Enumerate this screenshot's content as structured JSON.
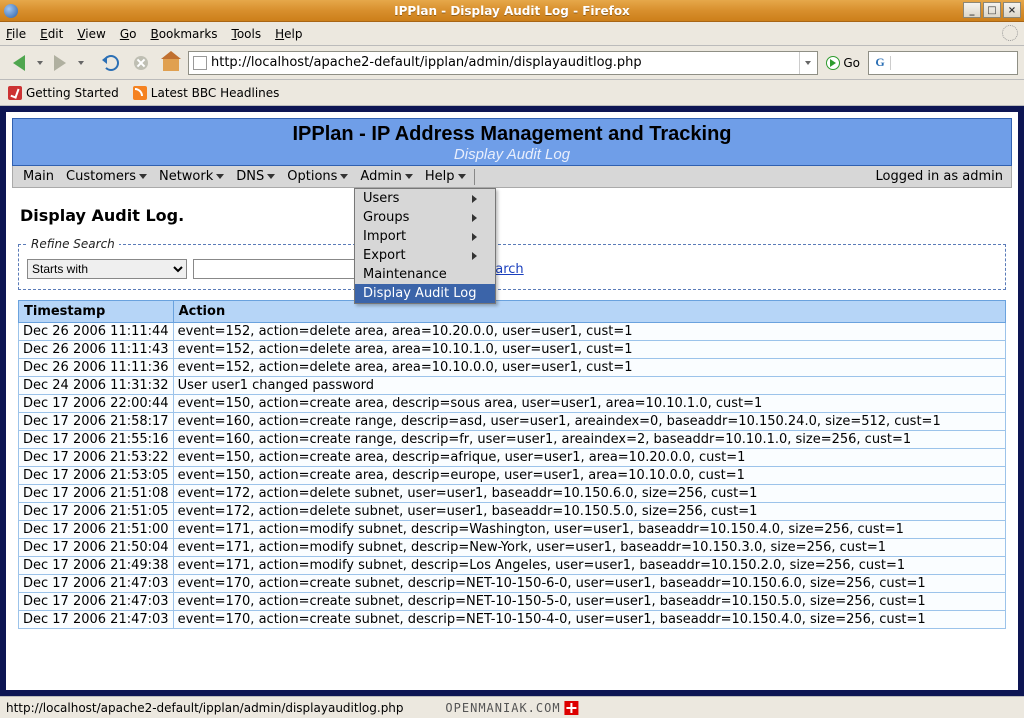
{
  "window": {
    "title": "IPPlan - Display Audit Log - Firefox"
  },
  "browser_menu": {
    "file": "File",
    "edit": "Edit",
    "view": "View",
    "go": "Go",
    "bookmarks": "Bookmarks",
    "tools": "Tools",
    "help": "Help"
  },
  "navbar": {
    "url": "http://localhost/apache2-default/ipplan/admin/displayauditlog.php",
    "go_label": "Go"
  },
  "bookmarks": {
    "getting_started": "Getting Started",
    "bbc": "Latest BBC Headlines"
  },
  "app": {
    "title": "IPPlan - IP Address Management and Tracking",
    "subtitle": "Display Audit Log",
    "login_status": "Logged in as admin",
    "menu": {
      "main": "Main",
      "customers": "Customers",
      "network": "Network",
      "dns": "DNS",
      "options": "Options",
      "admin": "Admin",
      "help": "Help"
    },
    "admin_menu": {
      "users": "Users",
      "groups": "Groups",
      "import": "Import",
      "export": "Export",
      "maintenance": "Maintenance",
      "display_audit_log": "Display Audit Log"
    },
    "page_heading": "Display Audit Log.",
    "refine": {
      "legend": "Refine Search",
      "mode": "Starts with",
      "query": "",
      "search_label": "Search"
    },
    "table": {
      "headers": {
        "timestamp": "Timestamp",
        "action": "Action"
      },
      "rows": [
        {
          "ts": "Dec 26 2006 11:11:44",
          "action": "event=152, action=delete area, area=10.20.0.0, user=user1, cust=1"
        },
        {
          "ts": "Dec 26 2006 11:11:43",
          "action": "event=152, action=delete area, area=10.10.1.0, user=user1, cust=1"
        },
        {
          "ts": "Dec 26 2006 11:11:36",
          "action": "event=152, action=delete area, area=10.10.0.0, user=user1, cust=1"
        },
        {
          "ts": "Dec 24 2006 11:31:32",
          "action": "User user1 changed password"
        },
        {
          "ts": "Dec 17 2006 22:00:44",
          "action": "event=150, action=create area, descrip=sous area, user=user1, area=10.10.1.0, cust=1"
        },
        {
          "ts": "Dec 17 2006 21:58:17",
          "action": "event=160, action=create range, descrip=asd, user=user1, areaindex=0, baseaddr=10.150.24.0, size=512, cust=1"
        },
        {
          "ts": "Dec 17 2006 21:55:16",
          "action": "event=160, action=create range, descrip=fr, user=user1, areaindex=2, baseaddr=10.10.1.0, size=256, cust=1"
        },
        {
          "ts": "Dec 17 2006 21:53:22",
          "action": "event=150, action=create area, descrip=afrique, user=user1, area=10.20.0.0, cust=1"
        },
        {
          "ts": "Dec 17 2006 21:53:05",
          "action": "event=150, action=create area, descrip=europe, user=user1, area=10.10.0.0, cust=1"
        },
        {
          "ts": "Dec 17 2006 21:51:08",
          "action": "event=172, action=delete subnet, user=user1, baseaddr=10.150.6.0, size=256, cust=1"
        },
        {
          "ts": "Dec 17 2006 21:51:05",
          "action": "event=172, action=delete subnet, user=user1, baseaddr=10.150.5.0, size=256, cust=1"
        },
        {
          "ts": "Dec 17 2006 21:51:00",
          "action": "event=171, action=modify subnet, descrip=Washington, user=user1, baseaddr=10.150.4.0, size=256, cust=1"
        },
        {
          "ts": "Dec 17 2006 21:50:04",
          "action": "event=171, action=modify subnet, descrip=New-York, user=user1, baseaddr=10.150.3.0, size=256, cust=1"
        },
        {
          "ts": "Dec 17 2006 21:49:38",
          "action": "event=171, action=modify subnet, descrip=Los Angeles, user=user1, baseaddr=10.150.2.0, size=256, cust=1"
        },
        {
          "ts": "Dec 17 2006 21:47:03",
          "action": "event=170, action=create subnet, descrip=NET-10-150-6-0, user=user1, baseaddr=10.150.6.0, size=256, cust=1"
        },
        {
          "ts": "Dec 17 2006 21:47:03",
          "action": "event=170, action=create subnet, descrip=NET-10-150-5-0, user=user1, baseaddr=10.150.5.0, size=256, cust=1"
        },
        {
          "ts": "Dec 17 2006 21:47:03",
          "action": "event=170, action=create subnet, descrip=NET-10-150-4-0, user=user1, baseaddr=10.150.4.0, size=256, cust=1"
        }
      ]
    }
  },
  "statusbar": {
    "text": "http://localhost/apache2-default/ipplan/admin/displayauditlog.php",
    "watermark": "OPENMANIAK.COM"
  }
}
